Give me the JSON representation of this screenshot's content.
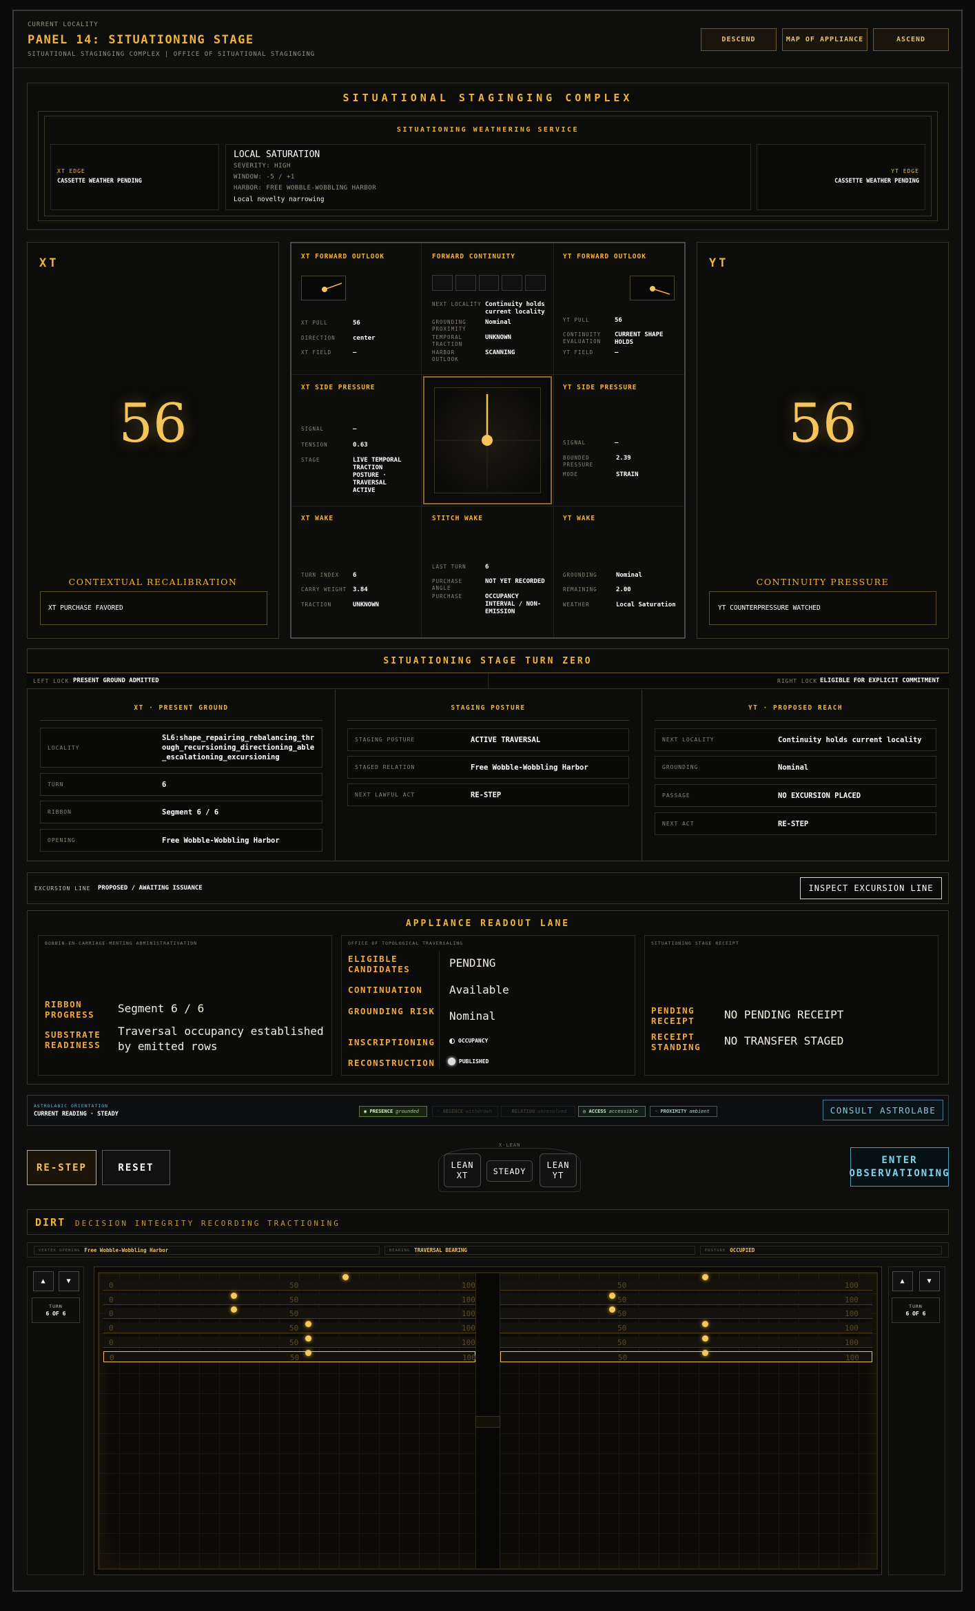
{
  "header": {
    "locality_label": "CURRENT LOCALITY",
    "title": "PANEL 14: SITUATIONING STAGE",
    "subtitle": "SITUATIONAL STAGINGING COMPLEX | OFFICE OF SITUATIONAL STAGINGING",
    "descend": "DESCEND",
    "map": "MAP OF APPLIANCE",
    "ascend": "ASCEND"
  },
  "complex": {
    "title": "SITUATIONAL STAGINGING COMPLEX",
    "weather_title": "SITUATIONING WEATHERING SERVICE",
    "xt_edge_label": "XT EDGE",
    "xt_edge_value": "CASSETTE WEATHER PENDING",
    "yt_edge_label": "YT EDGE",
    "yt_edge_value": "CASSETTE WEATHER PENDING",
    "sat_title": "LOCAL SATURATION",
    "severity": "SEVERITY: HIGH",
    "window": "WINDOW: -5 / +1",
    "harbor": "HARBOR: FREE WOBBLE-WOBBLING HARBOR",
    "note": "Local novelty narrowing"
  },
  "xt": {
    "label": "XT",
    "value": "56",
    "caption": "CONTEXTUAL RECALIBRATION",
    "box": "XT PURCHASE FAVORED"
  },
  "yt": {
    "label": "YT",
    "value": "56",
    "caption": "CONTINUITY PRESSURE",
    "box": "YT COUNTERPRESSURE WATCHED"
  },
  "grid": {
    "xtfo": {
      "title": "XT FORWARD OUTLOOK",
      "k1": "XT PULL",
      "v1": "56",
      "k2": "DIRECTION",
      "v2": "center",
      "k3": "XT FIELD",
      "v3": "—"
    },
    "fc": {
      "title": "FORWARD CONTINUITY",
      "k1": "NEXT LOCALITY",
      "v1": "Continuity holds current locality",
      "k2": "GROUNDING PROXIMITY",
      "v2": "Nominal",
      "k3": "TEMPORAL TRACTION",
      "v3": "UNKNOWN",
      "k4": "HARBOR OUTLOOK",
      "v4": "SCANNING"
    },
    "ytfo": {
      "title": "YT FORWARD OUTLOOK",
      "k1": "YT PULL",
      "v1": "56",
      "k2": "CONTINUITY EVALUATION",
      "v2": "CURRENT SHAPE HOLDS",
      "k3": "YT FIELD",
      "v3": "—"
    },
    "xtsp": {
      "title": "XT SIDE PRESSURE",
      "k1": "SIGNAL",
      "v1": "—",
      "k2": "TENSION",
      "v2": "0.63",
      "k3": "STAGE",
      "v3": "LIVE TEMPORAL TRACTION POSTURE · TRAVERSAL ACTIVE"
    },
    "ytsp": {
      "title": "YT SIDE PRESSURE",
      "k1": "SIGNAL",
      "v1": "—",
      "k2": "BOUNDED PRESSURE",
      "v2": "2.39",
      "k3": "MODE",
      "v3": "STRAIN"
    },
    "xtw": {
      "title": "XT WAKE",
      "k1": "TURN INDEX",
      "v1": "6",
      "k2": "CARRY WEIGHT",
      "v2": "3.84",
      "k3": "TRACTION",
      "v3": "UNKNOWN"
    },
    "sw": {
      "title": "STITCH WAKE",
      "k1": "LAST TURN",
      "v1": "6",
      "k2": "PURCHASE ANGLE",
      "v2": "NOT YET RECORDED",
      "k3": "PURCHASE",
      "v3": "OCCUPANCY INTERVAL / NON-EMISSION"
    },
    "ytw": {
      "title": "YT WAKE",
      "k1": "GROUNDING",
      "v1": "Nominal",
      "k2": "REMAINING",
      "v2": "2.00",
      "k3": "WEATHER",
      "v3": "Local Saturation"
    }
  },
  "turn": {
    "title": "SITUATIONING STAGE TURN ZERO",
    "left_k": "LEFT LOCK",
    "left_v": "PRESENT GROUND ADMITTED",
    "right_k": "RIGHT LOCK",
    "right_v": "ELIGIBLE FOR EXPLICIT COMMITMENT",
    "c1": {
      "title": "XT · PRESENT GROUND",
      "r1k": "LOCALITY",
      "r1v": "SL6:shape_repairing_rebalancing_through_recursioning_directioning_able_escalationing_excursioning",
      "r2k": "TURN",
      "r2v": "6",
      "r3k": "RIBBON",
      "r3v": "Segment 6 / 6",
      "r4k": "OPENING",
      "r4v": "Free Wobble-Wobbling Harbor"
    },
    "c2": {
      "title": "STAGING POSTURE",
      "r1k": "STAGING POSTURE",
      "r1v": "ACTIVE TRAVERSAL",
      "r2k": "STAGED RELATION",
      "r2v": "Free Wobble-Wobbling Harbor",
      "r3k": "NEXT LAWFUL ACT",
      "r3v": "RE-STEP"
    },
    "c3": {
      "title": "YT · PROPOSED REACH",
      "r1k": "NEXT LOCALITY",
      "r1v": "Continuity holds current locality",
      "r2k": "GROUNDING",
      "r2v": "Nominal",
      "r3k": "PASSAGE",
      "r3v": "NO EXCURSION PLACED",
      "r4k": "NEXT ACT",
      "r4v": "RE-STEP"
    }
  },
  "excursion": {
    "k": "EXCURSION LINE",
    "v": "PROPOSED / AWAITING ISSUANCE",
    "button": "INSPECT EXCURSION LINE"
  },
  "readout": {
    "title": "APPLIANCE READOUT LANE",
    "p1": "BOBBIN-EN-CARRIAGE-MENTING ADMINISTRATIVATION",
    "p1k1": "RIBBON PROGRESS",
    "p1v1": "Segment 6 / 6",
    "p1k2": "SUBSTRATE READINESS",
    "p1v2": "Traversal occupancy established by emitted rows",
    "p2": "OFFICE OF TOPOLOGICAL TRAVERSALING",
    "p2k1": "ELIGIBLE CANDIDATES",
    "p2v1": "PENDING",
    "p2k2": "CONTINUATION",
    "p2v2": "Available",
    "p2k3": "GROUNDING RISK",
    "p2v3": "Nominal",
    "p2k4": "INSCRIPTIONING",
    "p2v4": "OCCUPANCY",
    "p2k5": "RECONSTRUCTION",
    "p2v5": "PUBLISHED",
    "p3": "SITUATIONING STAGE RECEIPT",
    "p3k1": "PENDING RECEIPT",
    "p3v1": "NO PENDING RECEIPT",
    "p3k2": "RECEIPT STANDING",
    "p3v2": "NO TRANSFER STAGED"
  },
  "astro": {
    "k": "ASTROLABIC ORIENTATION",
    "v": "CURRENT READING · STEADY",
    "chips": [
      [
        "PRESENCE",
        "grounded"
      ],
      [
        "ABSENCE",
        "withdrawn"
      ],
      [
        "RELATION",
        "unresolved"
      ],
      [
        "ACCESS",
        "accessible"
      ],
      [
        "PROXIMITY",
        "ambient"
      ]
    ],
    "button": "CONSULT ASTROLABE"
  },
  "controls": {
    "restep": "RE-STEP",
    "reset": "RESET",
    "lean_label": "X-LEAN",
    "lean_xt": "LEAN XT",
    "steady": "STEADY",
    "lean_yt": "LEAN YT",
    "enter": "ENTER OBSERVATIONING"
  },
  "dirt": {
    "title_a": "DIRT",
    "title_b": "DECISION INTEGRITY RECORDING TRACTIONING",
    "s1k": "VERTEX OPENING",
    "s1v": "Free Wobble-Wobbling Harbor",
    "s2k": "BEARING",
    "s2v": "TRAVERSAL BEARING",
    "s3k": "POSTURE",
    "s3v": "OCCUPIED",
    "turn_k": "TURN",
    "turn_v": "6 OF 6",
    "ticks": [
      "0",
      "50",
      "100"
    ],
    "rows_left": [
      0.65,
      0.35,
      0.35,
      0.55,
      0.55,
      0.55
    ],
    "rows_right": [
      0.55,
      0.3,
      0.3,
      0.55,
      0.55,
      0.55
    ],
    "up": "▲",
    "down": "▼"
  },
  "colors": {
    "accent": "#f0b43c",
    "bg": "#0b0b0b",
    "cyan": "#7fd4e8"
  }
}
